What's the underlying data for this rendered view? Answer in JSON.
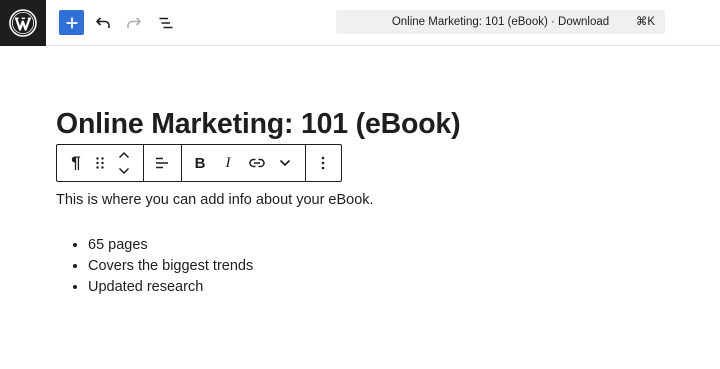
{
  "header": {
    "command_bar": {
      "title": "Online Marketing: 101 (eBook) · Download",
      "shortcut": "⌘K"
    },
    "icons": {
      "logo": "wordpress-logo",
      "add": "plus-icon",
      "undo": "undo-icon",
      "redo": "redo-icon",
      "outline": "document-overview-icon"
    },
    "colors": {
      "add_button": "#2f6fd6",
      "logo_bg": "#1e1e1e",
      "redo_disabled": "#b0b0b0"
    }
  },
  "document": {
    "title": "Online Marketing: 101 (eBook)",
    "paragraph": "This is where you can add info about your eBook.",
    "list": [
      "65 pages",
      "Covers the biggest trends",
      "Updated research"
    ]
  },
  "block_toolbar": {
    "buttons": [
      "paragraph-icon",
      "drag-handle-icon",
      "move-up-icon",
      "move-down-icon",
      "align-left-icon",
      "bold-icon",
      "italic-icon",
      "link-icon",
      "more-rich-text-chevron-icon",
      "block-options-icon"
    ],
    "bold_label": "B",
    "italic_label": "I",
    "paragraph_label": "¶"
  }
}
